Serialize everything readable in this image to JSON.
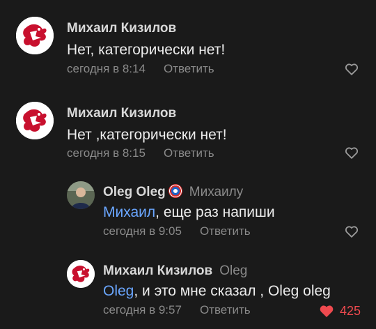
{
  "comments": [
    {
      "author": "Михаил Кизилов",
      "text": "Нет, категорически нет!",
      "time": "сегодня в 8:14",
      "reply_label": "Ответить"
    },
    {
      "author": "Михаил Кизилов",
      "text": "Нет ,категорически нет!",
      "time": "сегодня в 8:15",
      "reply_label": "Ответить"
    },
    {
      "author": "Oleg Oleg",
      "reply_to": "Михаилу",
      "mention": "Михаил",
      "text": ", еще раз напиши",
      "time": "сегодня в 9:05",
      "reply_label": "Ответить"
    },
    {
      "author": "Михаил Кизилов",
      "reply_to": "Oleg",
      "mention": "Oleg",
      "text": ", и это мне сказал , Oleg oleg",
      "time": "сегодня в 9:57",
      "reply_label": "Ответить",
      "likes": "425"
    }
  ],
  "colors": {
    "background": "#1a1a1a",
    "mention": "#6aa6ff",
    "like_active": "#ef4a4f"
  },
  "icons": {
    "avatar_dragon": "red-dragon-avatar",
    "like": "heart-outline-icon",
    "like_active": "heart-filled-icon"
  }
}
